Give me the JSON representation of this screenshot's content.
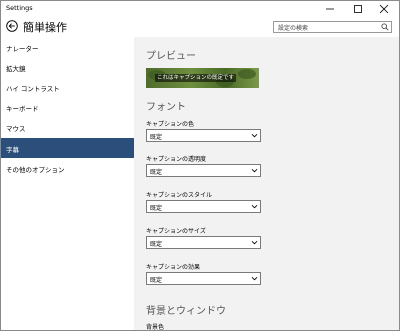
{
  "window": {
    "title": "Settings"
  },
  "header": {
    "title": "簡単操作",
    "search_placeholder": "設定の検索"
  },
  "sidebar": {
    "items": [
      {
        "label": "ナレーター",
        "active": false
      },
      {
        "label": "拡大鏡",
        "active": false
      },
      {
        "label": "ハイ コントラスト",
        "active": false
      },
      {
        "label": "キーボード",
        "active": false
      },
      {
        "label": "マウス",
        "active": false
      },
      {
        "label": "字幕",
        "active": true
      },
      {
        "label": "その他のオプション",
        "active": false
      }
    ]
  },
  "content": {
    "preview_heading": "プレビュー",
    "preview_caption": "これはキャプションの既定です",
    "font_heading": "フォント",
    "settings": [
      {
        "label": "キャプションの色",
        "value": "既定"
      },
      {
        "label": "キャプションの透明度",
        "value": "既定"
      },
      {
        "label": "キャプションのスタイル",
        "value": "既定"
      },
      {
        "label": "キャプションのサイズ",
        "value": "既定"
      },
      {
        "label": "キャプションの効果",
        "value": "既定"
      }
    ],
    "background_heading": "背景とウィンドウ",
    "background_color_label": "背景色"
  },
  "colors": {
    "active_nav": "#2b4f7a",
    "content_bg": "#f2f2f2"
  }
}
